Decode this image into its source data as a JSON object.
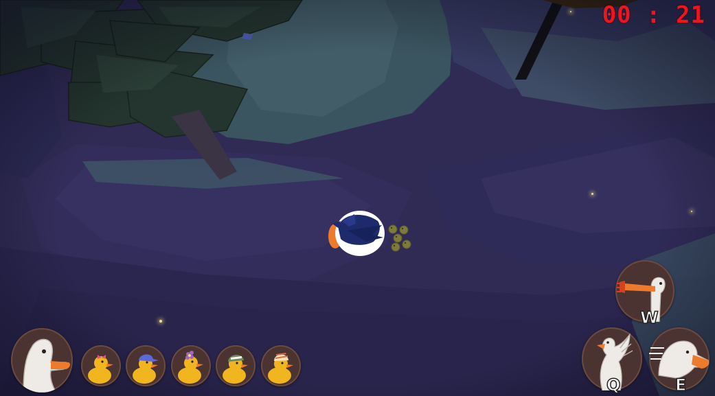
{
  "hud": {
    "timer": "00 : 21",
    "duck_count": 5,
    "abilities": {
      "honk_key": "W",
      "flap_key": "Q",
      "dash_key": "E"
    }
  },
  "colors": {
    "timer": "#f0141c",
    "portrait_bg": "#4a3330",
    "portrait_ring": "#6b4a3f",
    "goose_orange": "#ee7a2b",
    "duck_yellow": "#f1b51f",
    "night_ground": "#2e2a52"
  },
  "icons": {
    "main_portrait": "goose-head-icon",
    "ducklings": [
      "duck-bow-icon",
      "duck-cap-icon",
      "duck-flower-icon",
      "duck-helmet-icon",
      "duck-striped-hat-icon"
    ],
    "abilities": [
      "honk-icon",
      "wing-flap-icon",
      "dash-icon"
    ]
  }
}
